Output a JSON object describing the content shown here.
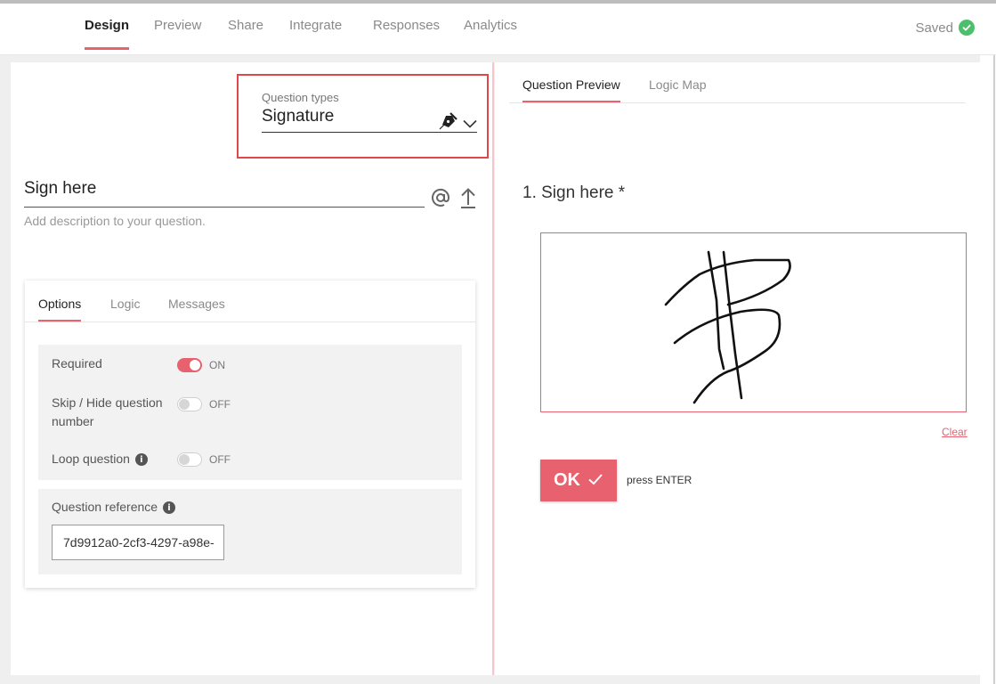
{
  "nav": {
    "tabs": [
      {
        "label": "Design"
      },
      {
        "label": "Preview"
      },
      {
        "label": "Share"
      },
      {
        "label": "Integrate"
      },
      {
        "label": "Responses"
      },
      {
        "label": "Analytics"
      }
    ],
    "status": "Saved"
  },
  "editor": {
    "question_types_label": "Question types",
    "question_type_value": "Signature",
    "question_title": "Sign here",
    "description_placeholder": "Add description to your question.",
    "options_tabs": [
      {
        "label": "Options"
      },
      {
        "label": "Logic"
      },
      {
        "label": "Messages"
      }
    ],
    "settings": {
      "required": {
        "label": "Required",
        "state": "ON"
      },
      "skip_hide": {
        "label": "Skip / Hide question number",
        "state": "OFF"
      },
      "loop": {
        "label": "Loop question",
        "state": "OFF"
      }
    },
    "reference_label": "Question reference",
    "reference_value": "7d9912a0-2cf3-4297-a98e-"
  },
  "preview": {
    "tabs": [
      {
        "label": "Question Preview"
      },
      {
        "label": "Logic Map"
      }
    ],
    "question": "1. Sign here *",
    "clear_label": "Clear",
    "ok_label": "OK",
    "hint": "press ENTER"
  },
  "colors": {
    "accent": "#e8616f",
    "success": "#4cbf6c",
    "highlight_border": "#e0474d"
  },
  "icons": [
    "checkmark-circle-icon",
    "pen-nib-icon",
    "chevron-down-icon",
    "at-sign-icon",
    "upload-icon",
    "info-icon",
    "checkmark-icon"
  ]
}
